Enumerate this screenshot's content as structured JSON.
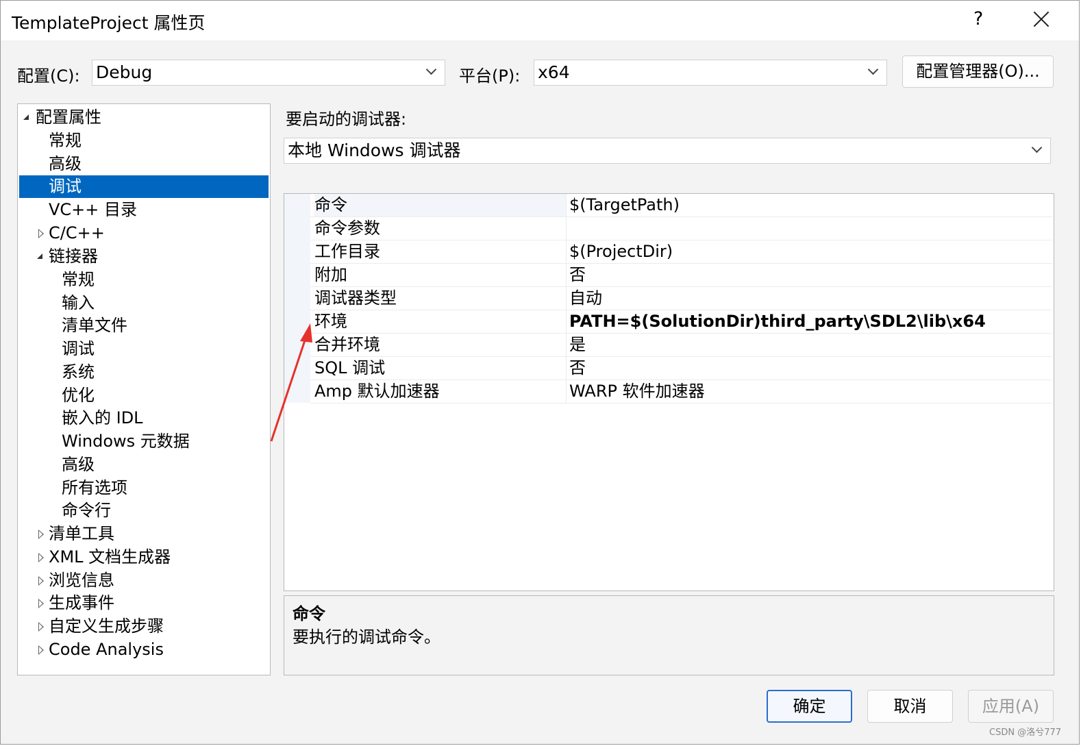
{
  "window": {
    "title": "TemplateProject 属性页",
    "help_label": "?"
  },
  "config_bar": {
    "config_label": "配置(C):",
    "config_value": "Debug",
    "platform_label": "平台(P):",
    "platform_value": "x64",
    "manager_button": "配置管理器(O)..."
  },
  "tree": {
    "items": [
      {
        "label": "配置属性"
      },
      {
        "label": "常规"
      },
      {
        "label": "高级"
      },
      {
        "label": "调试"
      },
      {
        "label": "VC++ 目录"
      },
      {
        "label": "C/C++"
      },
      {
        "label": "链接器"
      },
      {
        "label": "常规"
      },
      {
        "label": "输入"
      },
      {
        "label": "清单文件"
      },
      {
        "label": "调试"
      },
      {
        "label": "系统"
      },
      {
        "label": "优化"
      },
      {
        "label": "嵌入的 IDL"
      },
      {
        "label": "Windows 元数据"
      },
      {
        "label": "高级"
      },
      {
        "label": "所有选项"
      },
      {
        "label": "命令行"
      },
      {
        "label": "清单工具"
      },
      {
        "label": "XML 文档生成器"
      },
      {
        "label": "浏览信息"
      },
      {
        "label": "生成事件"
      },
      {
        "label": "自定义生成步骤"
      },
      {
        "label": "Code Analysis"
      }
    ]
  },
  "debugger": {
    "label": "要启动的调试器:",
    "value": "本地 Windows 调试器"
  },
  "properties": [
    {
      "name": "命令",
      "value": "$(TargetPath)"
    },
    {
      "name": "命令参数",
      "value": ""
    },
    {
      "name": "工作目录",
      "value": "$(ProjectDir)"
    },
    {
      "name": "附加",
      "value": "否"
    },
    {
      "name": "调试器类型",
      "value": "自动"
    },
    {
      "name": "环境",
      "value": "PATH=$(SolutionDir)third_party\\SDL2\\lib\\x64"
    },
    {
      "name": "合并环境",
      "value": "是"
    },
    {
      "name": "SQL 调试",
      "value": "否"
    },
    {
      "name": "Amp 默认加速器",
      "value": "WARP 软件加速器"
    }
  ],
  "description": {
    "title": "命令",
    "text": "要执行的调试命令。"
  },
  "buttons": {
    "ok": "确定",
    "cancel": "取消",
    "apply": "应用(A)"
  },
  "watermark": "CSDN @洛兮777",
  "colors": {
    "selection": "#0067c0",
    "annotation_arrow": "#e8302a"
  }
}
